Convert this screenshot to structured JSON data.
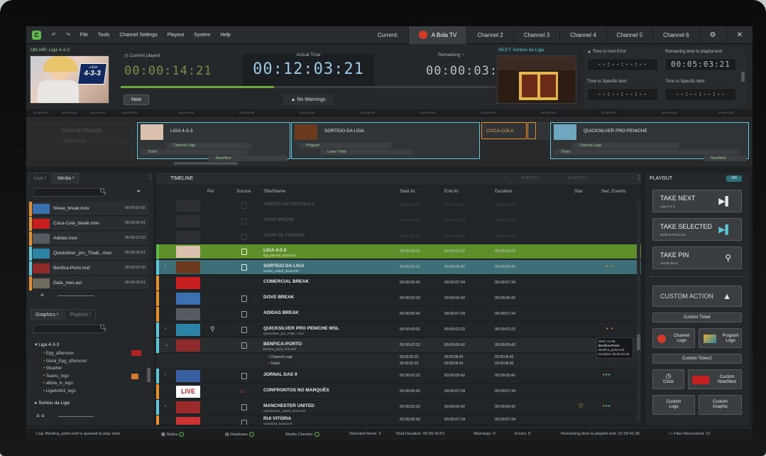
{
  "menu": {
    "file": "File",
    "tools": "Tools",
    "channel_settings": "Channel Settings",
    "playout": "Playout",
    "system": "System",
    "help": "Help"
  },
  "channels": {
    "current_label": "Current:",
    "tabs": [
      "A Bola TV",
      "Channel 2",
      "Channel 3",
      "Channel 4",
      "Channel 5",
      "Channel 6"
    ]
  },
  "onair": {
    "label": "ON AIR: Liga 4-3-3",
    "current_played_label": "Current played",
    "current_played": "00:00:14:21",
    "actual_time_label": "Actual Time",
    "actual_time": "00:12:03:21",
    "remaining_label": "Remaining",
    "remaining": "00:00:03:21",
    "now_button": "Now",
    "warnings": "No Warnings",
    "logo_text": "4-3-3",
    "logo_top": "LIGA"
  },
  "next": {
    "label": "NEXT: Sorteio da Liga"
  },
  "counters": {
    "time_to_error_label": "Time to next Error",
    "time_to_error": "--:--:--:--",
    "remaining_playlist_label": "Remaining time to playlist end",
    "remaining_playlist": "00:05:03:21",
    "specific_1_label": "Time to Specific item:",
    "specific_1": "--:--:--:--",
    "specific_2_label": "Time to Specific item:",
    "specific_2": "--:--:--:--"
  },
  "strip": {
    "clips": [
      "LIGA 4-3-3",
      "SORTEIO DA LIGA",
      "COCA-COLA",
      "QUICKSILVER PRO PENICHE",
      "TOUR DE FRANCE"
    ],
    "subs": {
      "channel_logo": "Channel Logo",
      "ticker": "Ticker",
      "now_next": "Now/Next",
      "program": "Program",
      "lower_third": "Lower Third"
    }
  },
  "leftpanel": {
    "tabs": [
      "Live",
      "Media"
    ],
    "media": [
      {
        "name": "Nivea_break.mov",
        "dur": "00:00:02:42"
      },
      {
        "name": "Coca-Cola_break.mov",
        "dur": "00:00:42:51"
      },
      {
        "name": "Adidas.mov",
        "dur": "00:00:12:22"
      },
      {
        "name": "Quicksilver_pro_Thaiti...mov",
        "dur": "00:00:42:51"
      },
      {
        "name": "Benfica-Porto.mxf",
        "dur": "00:00:02:42"
      },
      {
        "name": "Gala_meo.avi",
        "dur": "00:00:42:51"
      }
    ],
    "graphics_tabs": [
      "Graphics",
      "Playlists"
    ],
    "tree": {
      "root": "Liga 4-3-3",
      "items": [
        "Epg_afternoon",
        "Geral_Epg_afternoon",
        "Weather",
        "Teams_logo",
        "aBola_tv_logo",
        "Liga4x4x3_logo"
      ],
      "root2": "Sorteio da Liga"
    }
  },
  "timeline": {
    "tab": "TIMELINE",
    "playlist_tabs": [
      "PLAYLIST 1",
      "PLAYLIST 2"
    ],
    "columns": [
      "Pin",
      "Source",
      "Title/Name",
      "Start At",
      "End At",
      "Duration",
      "Star",
      "Sec. Events"
    ],
    "faded_rows": [
      {
        "title": "AMERICAN FOOTBALL",
        "start": "00:00:02:22",
        "end": "00:00:05:42",
        "dur": "00:00:05:42"
      },
      {
        "title": "DOVE BREAK",
        "start": "00:00:05:42",
        "end": "00:00:07:34",
        "dur": "00:00:07:34"
      },
      {
        "title": "TOUR DE FRANCE",
        "start": "00:00:02:22",
        "end": "00:00:05:42",
        "dur": "00:00:05:42"
      }
    ],
    "rows": [
      {
        "title": "LIGA 4-3-3",
        "sub": "liga_interval_0215.mxf",
        "start": "00:00:00:01",
        "end": "00:00:02:22",
        "dur": "00:00:02:22"
      },
      {
        "title": "SORTEIO DA LIGA",
        "sub": "sorteio_united_0215.mxf",
        "start": "00:00:02:22",
        "end": "00:00:05:42",
        "dur": "00:00:05:42"
      },
      {
        "title": "COMERCIAL BREAK",
        "sub": "",
        "start": "00:00:05:42",
        "end": "00:00:07:34",
        "dur": "00:00:07:34"
      },
      {
        "title": "DOVE BREAK",
        "sub": "",
        "start": "00:00:02:22",
        "end": "00:00:05:42",
        "dur": "00:00:05:42"
      },
      {
        "title": "ADIDAS BREAK",
        "sub": "",
        "start": "00:00:05:42",
        "end": "00:00:07:34",
        "dur": "00:00:07:34"
      },
      {
        "title": "QUICKSILVER PRO PENICHE WSL",
        "sub": "Quicksilver_pro_Thaiti...mov",
        "start": "00:00:00:01",
        "end": "00:00:02:22",
        "dur": "00:00:02:22"
      },
      {
        "title": "BENFICA-PORTO",
        "sub": "benfica_porto_075.mxf",
        "start": "00:00:02:22",
        "end": "00:00:05:42",
        "dur": "00:00:05:42"
      },
      {
        "title": "JORNAL DAS 9",
        "sub": "",
        "start": "00:00:02:22",
        "end": "00:00:05:42",
        "dur": "00:00:05:42"
      },
      {
        "title": "CONFRONTOS NO MARQUÊS",
        "sub": "",
        "start": "00:00:05:42",
        "end": "00:00:07:34",
        "dur": "00:00:07:34"
      },
      {
        "title": "MANCHESTER UNITED",
        "sub": "manchester_united_0215.mxf",
        "start": "00:00:02:22",
        "end": "00:00:05:42",
        "dur": "00:00:05:42"
      },
      {
        "title": "RUI VITÓRIA",
        "sub": "programa_0215.mxf",
        "start": "00:00:05:42",
        "end": "00:00:07:34",
        "dur": "00:00:07:34"
      }
    ],
    "benfica_sub": [
      {
        "title": "Channel Logo",
        "start": "00:00:02:22",
        "end": "00:00:05:42",
        "dur": "00:00:05:42"
      },
      {
        "title": "Ticker",
        "start": "00:00:02:22",
        "end": "00:00:05:42",
        "dur": "00:00:05:42"
      }
    ],
    "tooltip": {
      "start": "Start: 14:45",
      "title": "Benfica-Porto",
      "file": "Benfica_porto.mxf",
      "duration": "Duration: 00:00:42:35"
    },
    "live_badge": "LIVE"
  },
  "playout": {
    "title": "PLAYOUT",
    "toggle": "ON",
    "take_next": "TAKE NEXT",
    "take_next_sub": "Liga 4-3-3",
    "take_selected": "TAKE SELECTED",
    "take_selected_sub": "Benfica-Porto.mxf",
    "take_pin": "TAKE PIN",
    "take_pin_sub": "Jornal das 9",
    "custom_action": "CUSTOM ACTION",
    "custom_ticker": "Custom Ticker",
    "channel_logo": "Channel Logo",
    "program_logo": "Program Logo",
    "custom_ticker2": "Custom Ticker2",
    "clock": "Clock",
    "custom_now_next": "Custom Now/Next",
    "custom_logo": "Custom Logo",
    "custom_graphic": "Custom Graphic"
  },
  "status": {
    "log": "Log: Benfica_porto.mxf is queued to play next",
    "status": "Status",
    "database": "Database",
    "media_checker": "Media Checker",
    "selected": "Selected Items: 2",
    "total": "Total Duration: 00:35:42:51",
    "warnings": "Warnings: 0",
    "errors": "Errors: 0",
    "remaining": "Remaining time to playlist end: 22:25:41:35",
    "files": "Files Recovered: 12"
  },
  "colors": {
    "accent_green": "#5fb94a",
    "accent_teal": "#5ec8d8",
    "accent_orange": "#e8902a",
    "row_green": "#5f8f2a",
    "row_teal": "#3e6f78"
  }
}
